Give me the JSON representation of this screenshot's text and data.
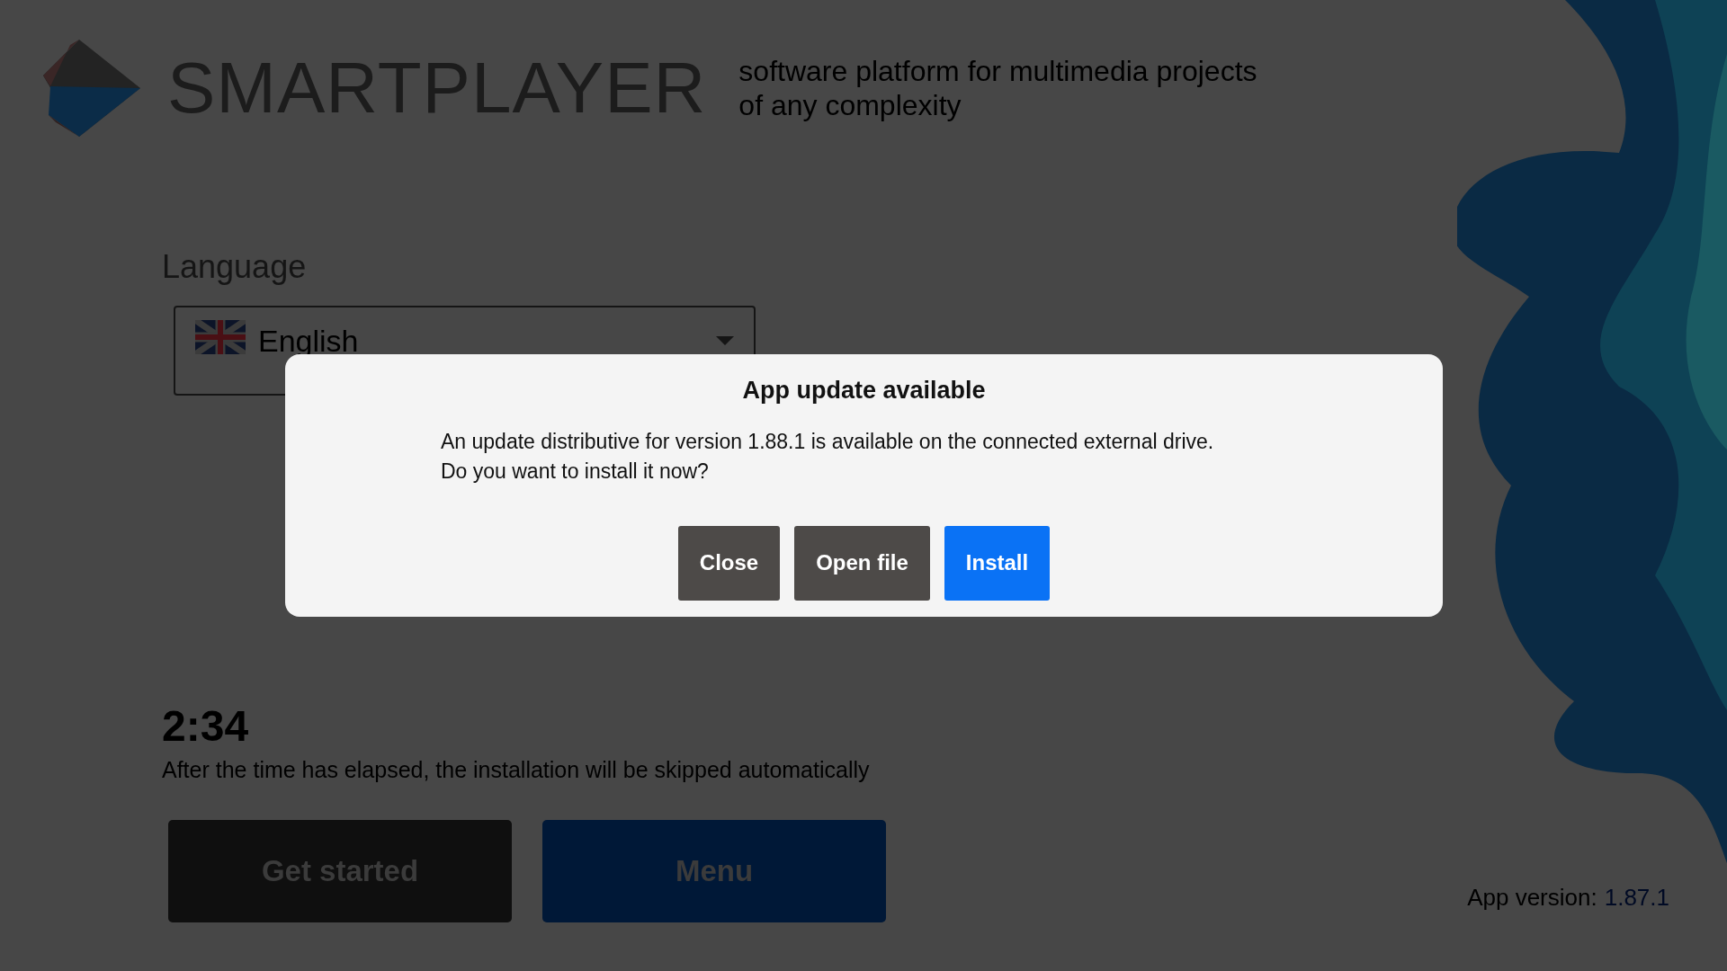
{
  "header": {
    "logo_text": "SMARTPLAYER",
    "tagline_lines": [
      "software platform for multimedia projects",
      "of any complexity"
    ]
  },
  "language": {
    "label": "Language",
    "value": "English"
  },
  "countdown": {
    "time": "2:34",
    "note": "After the time has elapsed, the installation will be skipped automatically"
  },
  "buttons": [
    {
      "label": "Get started",
      "kind": "dark"
    },
    {
      "label": "Menu",
      "kind": "blue"
    }
  ],
  "app_version": {
    "label": "App version:",
    "value": "1.87.1"
  },
  "dialog": {
    "title": "App update available",
    "message_lines": [
      "An update distributive for version 1.88.1 is available on the connected external drive.",
      "Do you want to install it now?"
    ],
    "buttons": [
      {
        "label": "Close",
        "kind": "secondary"
      },
      {
        "label": "Open file",
        "kind": "secondary"
      },
      {
        "label": "Install",
        "kind": "primary"
      }
    ]
  }
}
